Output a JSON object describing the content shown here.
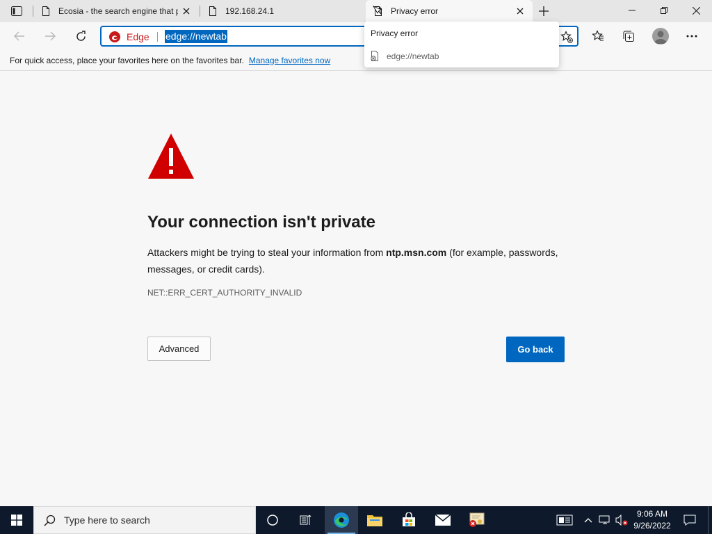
{
  "browser": {
    "tabs": [
      {
        "title": "Ecosia - the search engine that p",
        "active": false
      },
      {
        "title": "192.168.24.1",
        "active": false
      },
      {
        "title": "Privacy error",
        "active": true
      }
    ],
    "omnibox": {
      "brand_label": "Edge",
      "url": "edge://newtab"
    },
    "favorites_bar": {
      "text": "For quick access, place your favorites here on the favorites bar.",
      "link": "Manage favorites now"
    },
    "hover_card": {
      "title": "Privacy error",
      "url": "edge://newtab"
    }
  },
  "page": {
    "heading": "Your connection isn't private",
    "desc_prefix": "Attackers might be trying to steal your information from ",
    "desc_host": "ntp.msn.com",
    "desc_suffix": " (for example, passwords, messages, or credit cards).",
    "error_code": "NET::ERR_CERT_AUTHORITY_INVALID",
    "advanced_label": "Advanced",
    "back_label": "Go back",
    "colors": {
      "accent": "#0067c0",
      "warning": "#d00000"
    }
  },
  "taskbar": {
    "search_placeholder": "Type here to search",
    "time": "9:06 AM",
    "date": "9/26/2022"
  }
}
